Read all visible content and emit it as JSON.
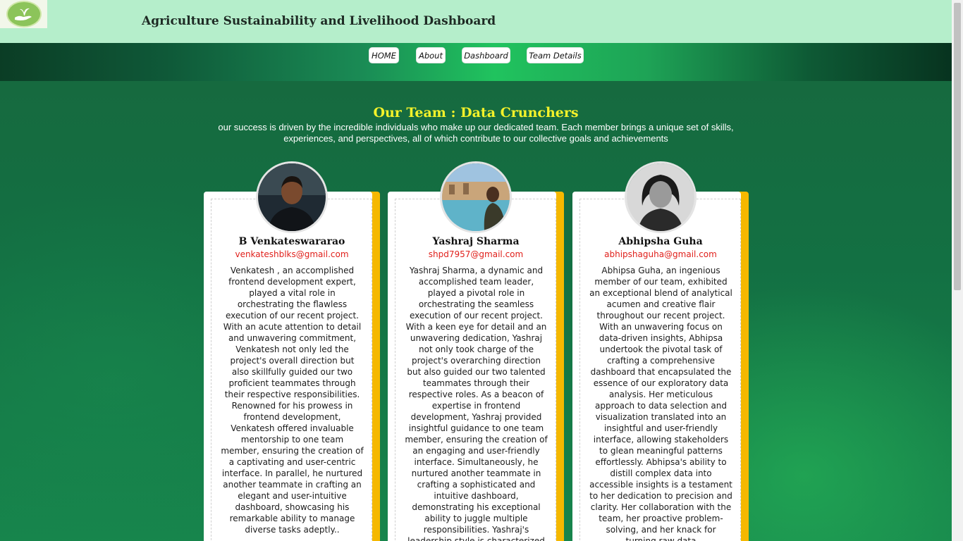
{
  "header": {
    "logo_icon": "hands-with-sprout-logo",
    "title": "Agriculture Sustainability and Livelihood Dashboard"
  },
  "nav": {
    "items": [
      {
        "label": "HOME"
      },
      {
        "label": "About"
      },
      {
        "label": "Dashboard"
      },
      {
        "label": "Team Details"
      }
    ]
  },
  "team": {
    "title": "Our Team : Data Crunchers",
    "subtitle": "our success is driven by the incredible individuals who make up our dedicated team. Each member brings a unique set of skills, experiences, and perspectives, all of which contribute to our collective goals and achievements",
    "members": [
      {
        "name": "B Venkateswararao",
        "email": "venkateshblks@gmail.com",
        "bio": "Venkatesh , an accomplished frontend development expert, played a vital role in orchestrating the flawless execution of our recent project. With an acute attention to detail and unwavering commitment, Venkatesh not only led the project's overall direction but also skillfully guided our two proficient teammates through their respective responsibilities. Renowned for his prowess in frontend development, Venkatesh offered invaluable mentorship to one team member, ensuring the creation of a captivating and user-centric interface. In parallel, he nurtured another teammate in crafting an elegant and user-intuitive dashboard, showcasing his remarkable ability to manage diverse tasks adeptly.."
      },
      {
        "name": "Yashraj Sharma",
        "email": "shpd7957@gmail.com",
        "bio": "Yashraj Sharma, a dynamic and accomplished team leader, played a pivotal role in orchestrating the seamless execution of our recent project. With a keen eye for detail and an unwavering dedication, Yashraj not only took charge of the project's overarching direction but also guided our two talented teammates through their respective roles. As a beacon of expertise in frontend development, Yashraj provided insightful guidance to one team member, ensuring the creation of an engaging and user-friendly interface. Simultaneously, he nurtured another teammate in crafting a sophisticated and intuitive dashboard, demonstrating his exceptional ability to juggle multiple responsibilities. Yashraj's leadership style is characterized"
      },
      {
        "name": "Abhipsha Guha",
        "email": "abhipshaguha@gmail.com",
        "bio": "Abhipsa Guha, an ingenious member of our team, exhibited an exceptional blend of analytical acumen and creative flair throughout our recent project. With an unwavering focus on data-driven insights, Abhipsa undertook the pivotal task of crafting a comprehensive dashboard that encapsulated the essence of our exploratory data analysis. Her meticulous approach to data selection and visualization translated into an insightful and user-friendly interface, allowing stakeholders to glean meaningful patterns effortlessly. Abhipsa's ability to distill complex data into accessible insights is a testament to her dedication to precision and clarity. Her collaboration with the team, her proactive problem-solving, and her knack for turning raw data"
      }
    ]
  },
  "colors": {
    "header_bg": "#b5eecb",
    "title_yellow": "#f4f22a",
    "email_red": "#e0201b",
    "card_accent": "#f5b800"
  }
}
